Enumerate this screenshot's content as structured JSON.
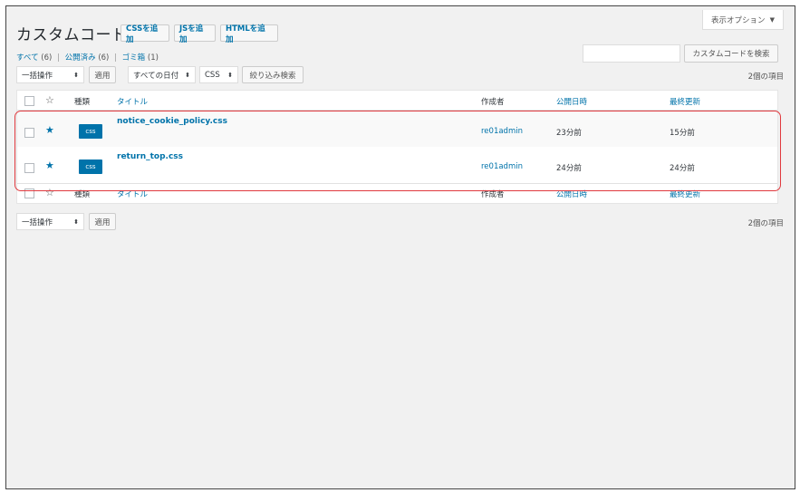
{
  "header": {
    "title": "カスタムコード",
    "add_buttons": [
      "CSSを追加",
      "JSを追加",
      "HTMLを追加"
    ],
    "screen_options": "表示オプション",
    "screen_options_icon": "caret-down-icon"
  },
  "filters": {
    "all_label": "すべて",
    "all_count": "(6)",
    "published_label": "公開済み",
    "published_count": "(6)",
    "trash_label": "ゴミ箱",
    "trash_count": "(1)",
    "separator": "|"
  },
  "search": {
    "placeholder": "",
    "button": "カスタムコードを検索"
  },
  "toolbar_top": {
    "bulk_action": "一括操作",
    "apply": "適用",
    "date_filter": "すべての日付",
    "type_filter": "CSS",
    "filter_button": "絞り込み検索",
    "items_count": "2個の項目"
  },
  "table": {
    "columns": {
      "type": "種類",
      "title": "タイトル",
      "author": "作成者",
      "date": "公開日時",
      "modified": "最終更新"
    },
    "rows": [
      {
        "type_badge": "css",
        "title": "notice_cookie_policy.css",
        "author": "re01admin",
        "date": "23分前",
        "modified": "15分前",
        "starred": true
      },
      {
        "type_badge": "css",
        "title": "return_top.css",
        "author": "re01admin",
        "date": "24分前",
        "modified": "24分前",
        "starred": true
      }
    ]
  },
  "toolbar_bottom": {
    "bulk_action": "一括操作",
    "apply": "適用",
    "items_count": "2個の項目"
  },
  "colors": {
    "accent": "#0073aa",
    "highlight": "#e0393e",
    "background": "#f1f1f1"
  }
}
